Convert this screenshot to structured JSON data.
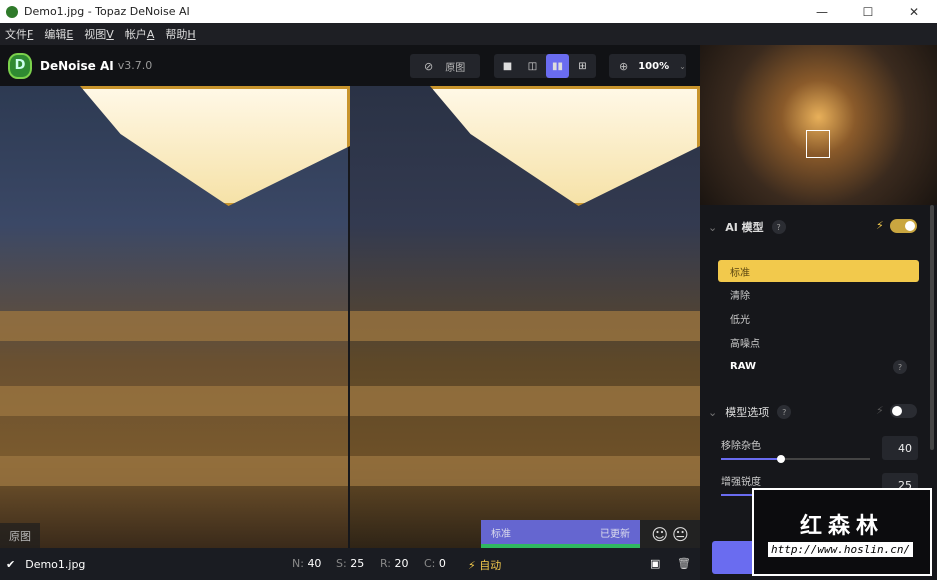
{
  "window": {
    "title": "Demo1.jpg - Topaz DeNoise AI",
    "minimize": "—",
    "maximize": "☐",
    "close": "✕"
  },
  "menu": [
    {
      "label": "文件",
      "key": "F"
    },
    {
      "label": "编辑",
      "key": "E"
    },
    {
      "label": "视图",
      "key": "V"
    },
    {
      "label": "帐户",
      "key": "A"
    },
    {
      "label": "帮助",
      "key": "H"
    }
  ],
  "toolbar": {
    "app_name": "DeNoise AI",
    "version": "v3.7.0",
    "original_label": "原图",
    "zoom": "100%",
    "logo_letter": "D"
  },
  "preview": {
    "original_label": "原图",
    "model_status": "标准",
    "update_status": "已更新"
  },
  "bottom": {
    "filename": "Demo1.jpg",
    "n_label": "N:",
    "n": "40",
    "s_label": "S:",
    "s": "25",
    "r_label": "R:",
    "r": "20",
    "c_label": "C:",
    "c": "0",
    "auto": "自动"
  },
  "panel": {
    "ai_model": {
      "title": "AI 模型",
      "enabled": true,
      "models": [
        "标准",
        "清除",
        "低光",
        "高噪点",
        "RAW"
      ],
      "selected": "标准"
    },
    "model_options": {
      "title": "模型选项",
      "enabled": false,
      "sliders": [
        {
          "label": "移除杂色",
          "value": "40"
        },
        {
          "label": "增强锐度",
          "value": "25"
        }
      ]
    }
  },
  "watermark": {
    "title": "红森林",
    "url": "http://www.hoslin.cn/"
  }
}
